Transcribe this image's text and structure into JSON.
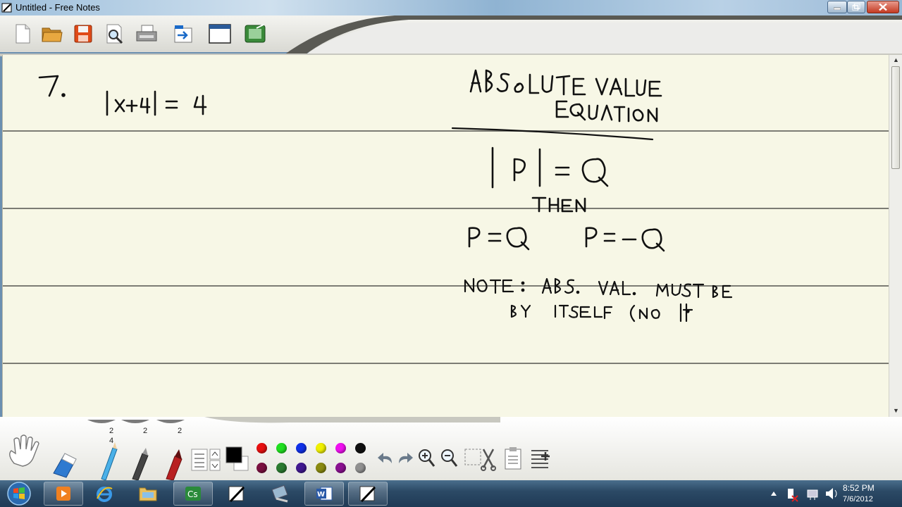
{
  "window": {
    "title": "Untitled - Free Notes"
  },
  "toolbar": {
    "icons": [
      "new-page-icon",
      "open-folder-icon",
      "save-icon",
      "print-preview-icon",
      "print-icon",
      "export-icon",
      "window-icon",
      "screen-capture-icon"
    ]
  },
  "pens": {
    "widths": [
      "2",
      "2",
      "2"
    ],
    "pencil_width": "4"
  },
  "palette": {
    "current": "#000000",
    "bright": [
      "#e81010",
      "#20e020",
      "#1030e8",
      "#f0f000",
      "#f010f0",
      "#101010"
    ],
    "dark": [
      "#7a1040",
      "#2a7a30",
      "#401890",
      "#8a8a10",
      "#8a1090",
      "#909090"
    ]
  },
  "taskbar": {
    "apps": [
      "media-player-icon",
      "internet-explorer-icon",
      "file-explorer-icon",
      "camtasia-icon",
      "free-notes-icon",
      "network-icon",
      "word-icon",
      "free-notes-icon"
    ]
  },
  "clock": {
    "time": "8:52 PM",
    "date": "7/6/2012"
  }
}
